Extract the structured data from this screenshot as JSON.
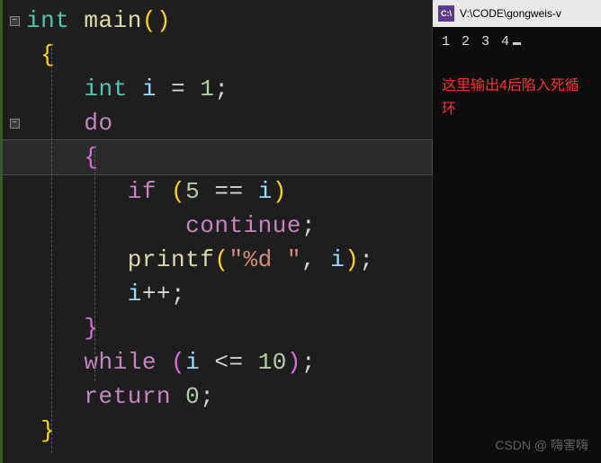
{
  "code": {
    "l1_type": "int",
    "l1_fn": "main",
    "l1_par_o": "(",
    "l1_par_c": ")",
    "l2_brace": "{",
    "l3_type": "int",
    "l3_ident": "i",
    "l3_eq": "=",
    "l3_num": "1",
    "l3_semi": ";",
    "l4_do": "do",
    "l5_brace": "{",
    "l6_if": "if",
    "l6_par_o": "(",
    "l6_num": "5",
    "l6_eq": "==",
    "l6_ident": "i",
    "l6_par_c": ")",
    "l7_cont": "continue",
    "l7_semi": ";",
    "l8_fn": "printf",
    "l8_par_o": "(",
    "l8_str": "\"%d \"",
    "l8_comma": ",",
    "l8_ident": "i",
    "l8_par_c": ")",
    "l8_semi": ";",
    "l9_ident": "i",
    "l9_op": "++",
    "l9_semi": ";",
    "l10_brace": "}",
    "l11_while": "while",
    "l11_par_o": "(",
    "l11_ident": "i",
    "l11_op": "<=",
    "l11_num": "10",
    "l11_par_c": ")",
    "l11_semi": ";",
    "l12_ret": "return",
    "l12_num": "0",
    "l12_semi": ";",
    "l13_brace": "}"
  },
  "console": {
    "icon": "C:\\",
    "title": "V:\\CODE\\gongweis-v",
    "output": "1 2 3 4",
    "annotation": "这里输出4后陷入死循环"
  },
  "watermark": "CSDN @ 嗨害嗨"
}
